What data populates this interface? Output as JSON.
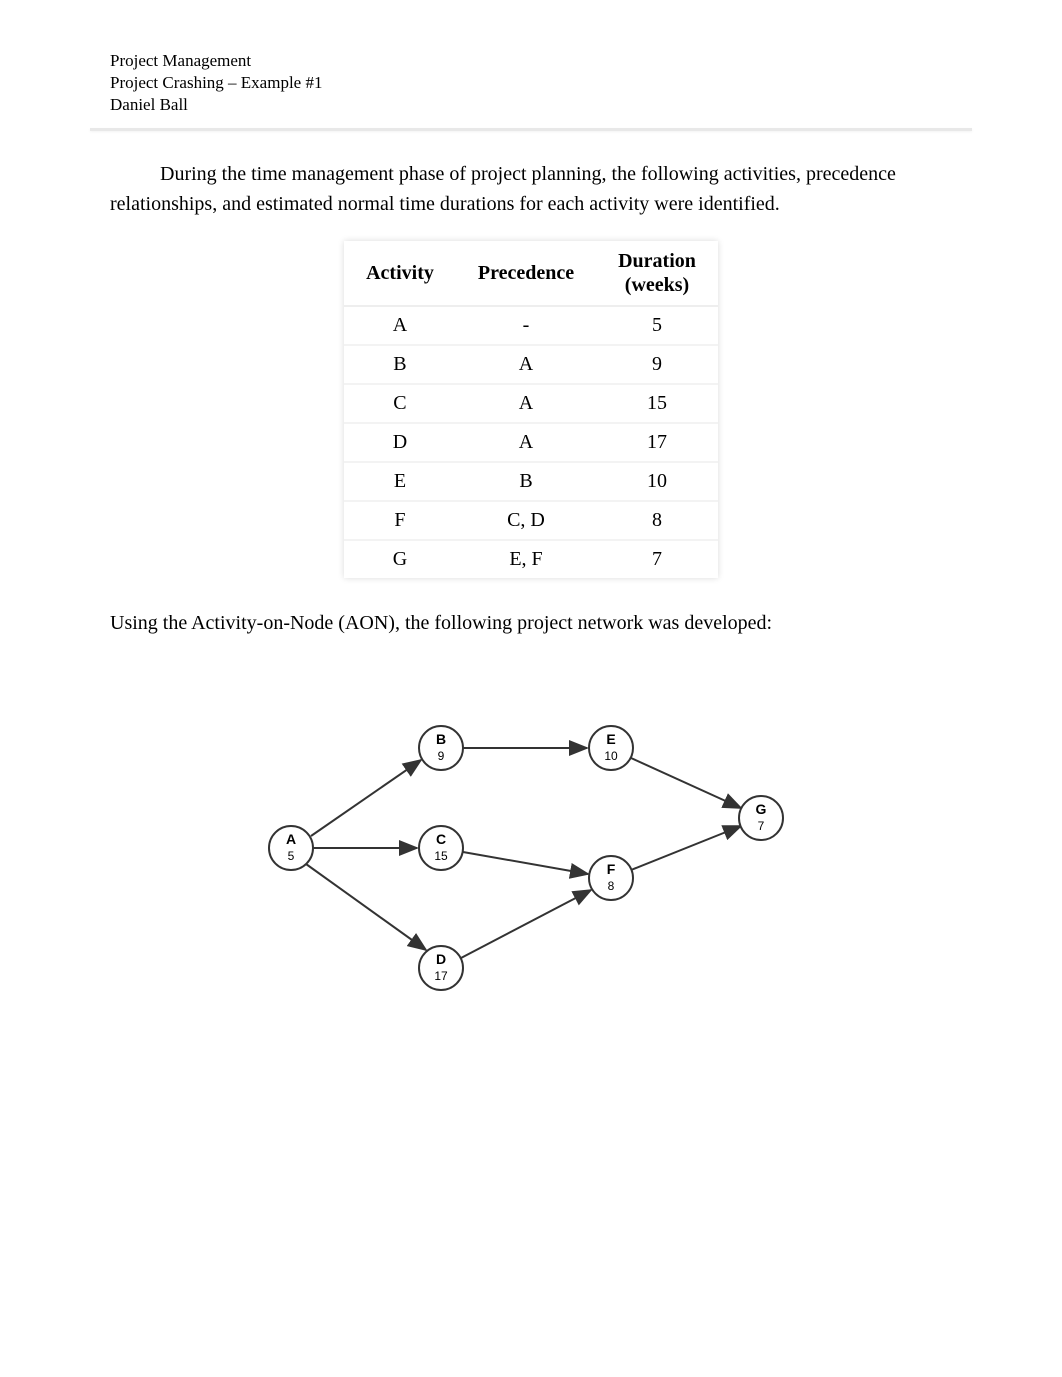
{
  "header": {
    "line1": "Project Management",
    "line2": "Project Crashing – Example #1",
    "line3": "Daniel Ball"
  },
  "intro": "During the time management phase of project planning, the following activities, precedence relationships, and estimated normal time durations for each activity were identified.",
  "table": {
    "col_activity": "Activity",
    "col_precedence": "Precedence",
    "col_duration": "Duration (weeks)",
    "rows": [
      {
        "activity": "A",
        "precedence": "-",
        "duration": "5"
      },
      {
        "activity": "B",
        "precedence": "A",
        "duration": "9"
      },
      {
        "activity": "C",
        "precedence": "A",
        "duration": "15"
      },
      {
        "activity": "D",
        "precedence": "A",
        "duration": "17"
      },
      {
        "activity": "E",
        "precedence": "B",
        "duration": "10"
      },
      {
        "activity": "F",
        "precedence": "C, D",
        "duration": "8"
      },
      {
        "activity": "G",
        "precedence": "E, F",
        "duration": "7"
      }
    ]
  },
  "aon_text": "Using the Activity-on-Node (AON), the following project network was developed:",
  "diagram": {
    "nodes": {
      "A": {
        "label": "A",
        "sub": "5"
      },
      "B": {
        "label": "B",
        "sub": "9"
      },
      "C": {
        "label": "C",
        "sub": "15"
      },
      "D": {
        "label": "D",
        "sub": "17"
      },
      "E": {
        "label": "E",
        "sub": "10"
      },
      "F": {
        "label": "F",
        "sub": "8"
      },
      "G": {
        "label": "G",
        "sub": "7"
      }
    }
  }
}
